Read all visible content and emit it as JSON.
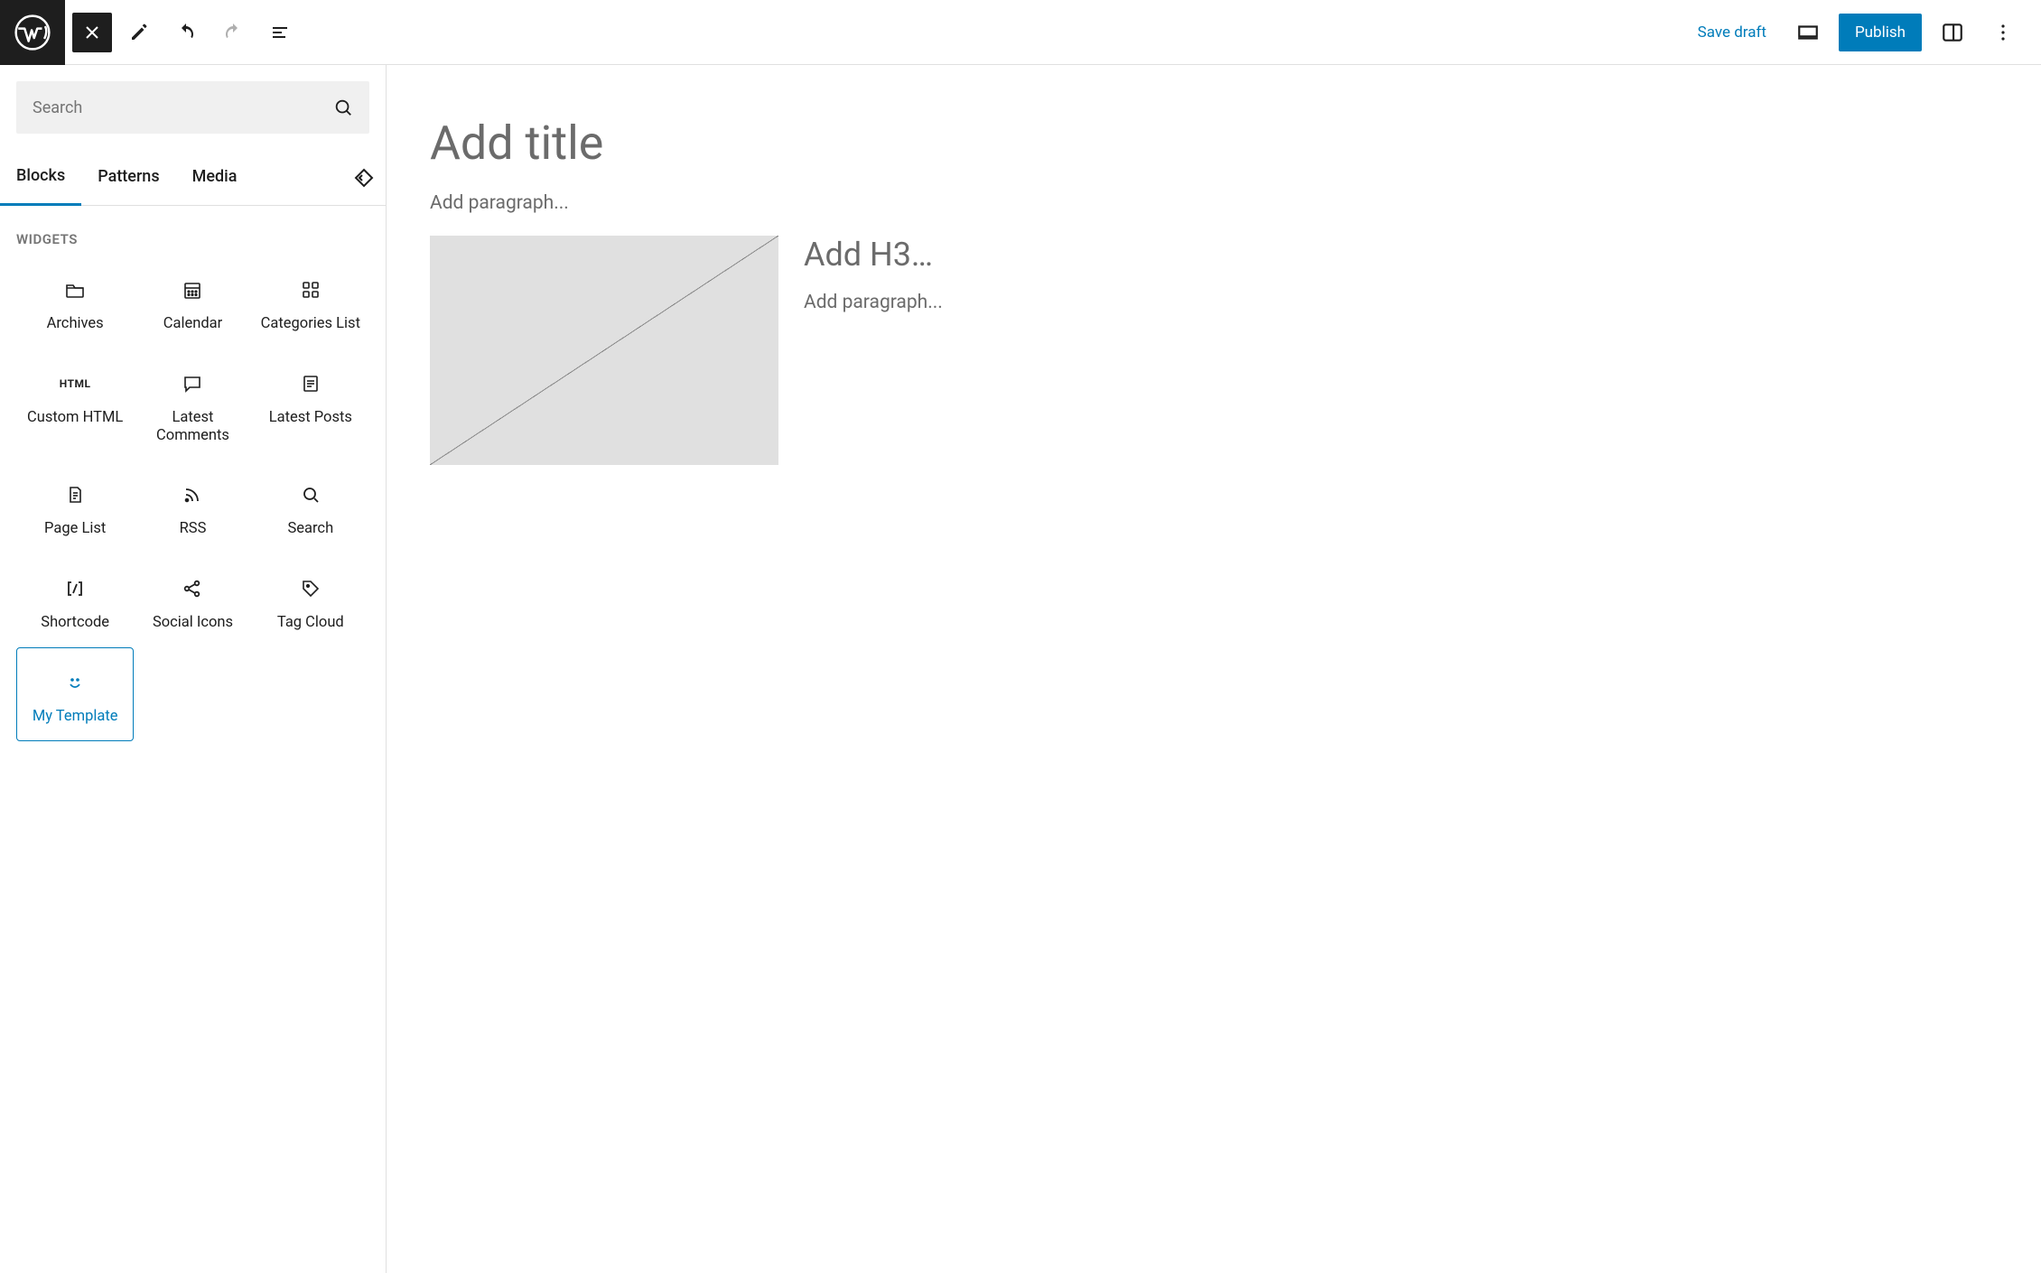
{
  "topbar": {
    "save_draft": "Save draft",
    "publish": "Publish"
  },
  "inserter": {
    "search_placeholder": "Search",
    "tabs": {
      "blocks": "Blocks",
      "patterns": "Patterns",
      "media": "Media"
    },
    "section": "WIDGETS",
    "blocks": {
      "archives": "Archives",
      "calendar": "Calendar",
      "categories": "Categories List",
      "custom_html": "Custom HTML",
      "custom_html_icon": "HTML",
      "latest_comments": "Latest Comments",
      "latest_posts": "Latest Posts",
      "page_list": "Page List",
      "rss": "RSS",
      "search": "Search",
      "shortcode": "Shortcode",
      "social_icons": "Social Icons",
      "tag_cloud": "Tag Cloud",
      "my_template": "My Template"
    }
  },
  "canvas": {
    "title_placeholder": "Add title",
    "paragraph_placeholder": "Add paragraph...",
    "h3_placeholder": "Add H3…",
    "paragraph2_placeholder": "Add paragraph..."
  }
}
